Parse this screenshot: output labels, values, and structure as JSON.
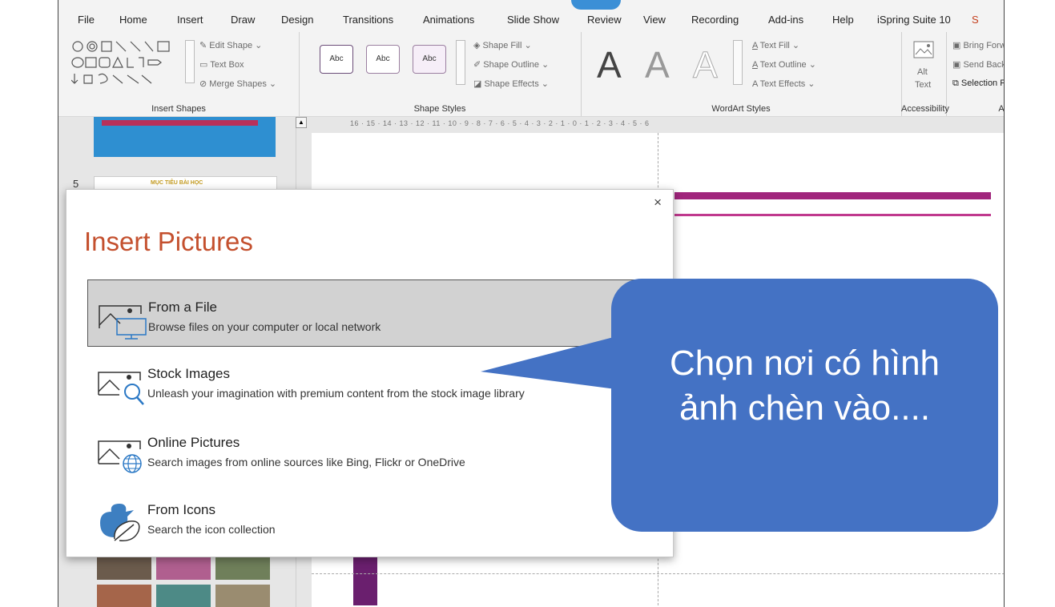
{
  "ribbon_tabs": [
    "File",
    "Home",
    "Insert",
    "Draw",
    "Design",
    "Transitions",
    "Animations",
    "Slide Show",
    "Review",
    "View",
    "Recording",
    "Add-ins",
    "Help",
    "iSpring Suite 10",
    "S"
  ],
  "ribbon": {
    "insert_shapes": {
      "edit_shape": "Edit Shape",
      "text_box": "Text Box",
      "merge_shapes": "Merge Shapes",
      "label": "Insert Shapes"
    },
    "shape_styles": {
      "sample": "Abc",
      "fill": "Shape Fill",
      "outline": "Shape Outline",
      "effects": "Shape Effects",
      "label": "Shape Styles"
    },
    "wordart": {
      "letter": "A",
      "fill": "Text Fill",
      "outline": "Text Outline",
      "effects": "Text Effects",
      "label": "WordArt Styles"
    },
    "accessibility": {
      "alt": "Alt",
      "text": "Text",
      "label": "Accessibility"
    },
    "arrange": {
      "bring_forward": "Bring Forward",
      "send_backward": "Send Backwar",
      "selection_pane": "Selection Pane",
      "label": "Arr"
    }
  },
  "ruler_text": "16 · 15 · 14 · 13 · 12 · 11 · 10 · 9 · 8 · 7 · 6 · 5 · 4 · 3 · 2 · 1 · 0 · 1 · 2 · 3 · 4 · 5 · 6",
  "thumbs": {
    "slide_number": "5",
    "slide5_title": "MỤC TIÊU BÀI HỌC"
  },
  "dialog": {
    "title": "Insert Pictures",
    "close": "×",
    "options": [
      {
        "title": "From a File",
        "subtitle": "Browse files on your computer or local network"
      },
      {
        "title": "Stock Images",
        "subtitle": "Unleash your imagination with premium content from the stock image library"
      },
      {
        "title": "Online Pictures",
        "subtitle": "Search images from online sources like Bing, Flickr or OneDrive"
      },
      {
        "title": "From Icons",
        "subtitle": "Search the icon collection"
      }
    ]
  },
  "callout": {
    "line1": "Chọn nơi có hình",
    "line2": "ảnh chèn vào...."
  },
  "colors": {
    "accent": "#c4502e",
    "callout": "#4472c4",
    "selected": "#d2d2d2"
  }
}
